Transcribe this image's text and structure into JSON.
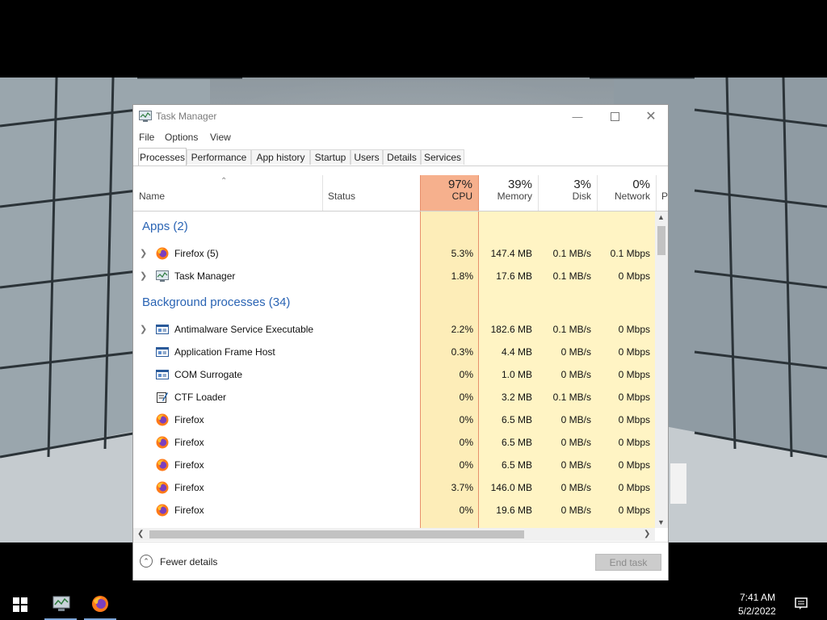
{
  "window": {
    "title": "Task Manager",
    "menu": [
      "File",
      "Options",
      "View"
    ],
    "tabs": [
      "Processes",
      "Performance",
      "App history",
      "Startup",
      "Users",
      "Details",
      "Services"
    ],
    "active_tab": "Processes"
  },
  "columns": {
    "name": "Name",
    "status": "Status",
    "cpu": {
      "pct": "97%",
      "label": "CPU"
    },
    "memory": {
      "pct": "39%",
      "label": "Memory"
    },
    "disk": {
      "pct": "3%",
      "label": "Disk"
    },
    "network": {
      "pct": "0%",
      "label": "Network"
    },
    "power_partial": "P"
  },
  "groups": {
    "apps": "Apps (2)",
    "background": "Background processes (34)"
  },
  "apps": [
    {
      "name": "Firefox (5)",
      "icon": "firefox-icon",
      "expandable": true,
      "cpu": "5.3%",
      "memory": "147.4 MB",
      "disk": "0.1 MB/s",
      "network": "0.1 Mbps"
    },
    {
      "name": "Task Manager",
      "icon": "task-manager-icon",
      "expandable": true,
      "cpu": "1.8%",
      "memory": "17.6 MB",
      "disk": "0.1 MB/s",
      "network": "0 Mbps"
    }
  ],
  "background": [
    {
      "name": "Antimalware Service Executable",
      "icon": "service-icon",
      "expandable": true,
      "cpu": "2.2%",
      "memory": "182.6 MB",
      "disk": "0.1 MB/s",
      "network": "0 Mbps"
    },
    {
      "name": "Application Frame Host",
      "icon": "service-icon",
      "expandable": false,
      "cpu": "0.3%",
      "memory": "4.4 MB",
      "disk": "0 MB/s",
      "network": "0 Mbps"
    },
    {
      "name": "COM Surrogate",
      "icon": "service-icon",
      "expandable": false,
      "cpu": "0%",
      "memory": "1.0 MB",
      "disk": "0 MB/s",
      "network": "0 Mbps"
    },
    {
      "name": "CTF Loader",
      "icon": "ctf-loader-icon",
      "expandable": false,
      "cpu": "0%",
      "memory": "3.2 MB",
      "disk": "0.1 MB/s",
      "network": "0 Mbps"
    },
    {
      "name": "Firefox",
      "icon": "firefox-icon",
      "expandable": false,
      "cpu": "0%",
      "memory": "6.5 MB",
      "disk": "0 MB/s",
      "network": "0 Mbps"
    },
    {
      "name": "Firefox",
      "icon": "firefox-icon",
      "expandable": false,
      "cpu": "0%",
      "memory": "6.5 MB",
      "disk": "0 MB/s",
      "network": "0 Mbps"
    },
    {
      "name": "Firefox",
      "icon": "firefox-icon",
      "expandable": false,
      "cpu": "0%",
      "memory": "6.5 MB",
      "disk": "0 MB/s",
      "network": "0 Mbps"
    },
    {
      "name": "Firefox",
      "icon": "firefox-icon",
      "expandable": false,
      "cpu": "3.7%",
      "memory": "146.0 MB",
      "disk": "0 MB/s",
      "network": "0 Mbps"
    },
    {
      "name": "Firefox",
      "icon": "firefox-icon",
      "expandable": false,
      "cpu": "0%",
      "memory": "19.6 MB",
      "disk": "0 MB/s",
      "network": "0 Mbps"
    }
  ],
  "footer": {
    "fewer_details": "Fewer details",
    "end_task": "End task"
  },
  "taskbar": {
    "time": "7:41 AM",
    "date": "5/2/2022"
  },
  "colors": {
    "cpu_header": "#f6b08d",
    "cpu_cells": "#fdedb8",
    "other_cells": "#fff4c4",
    "group_text": "#2a64b4"
  }
}
